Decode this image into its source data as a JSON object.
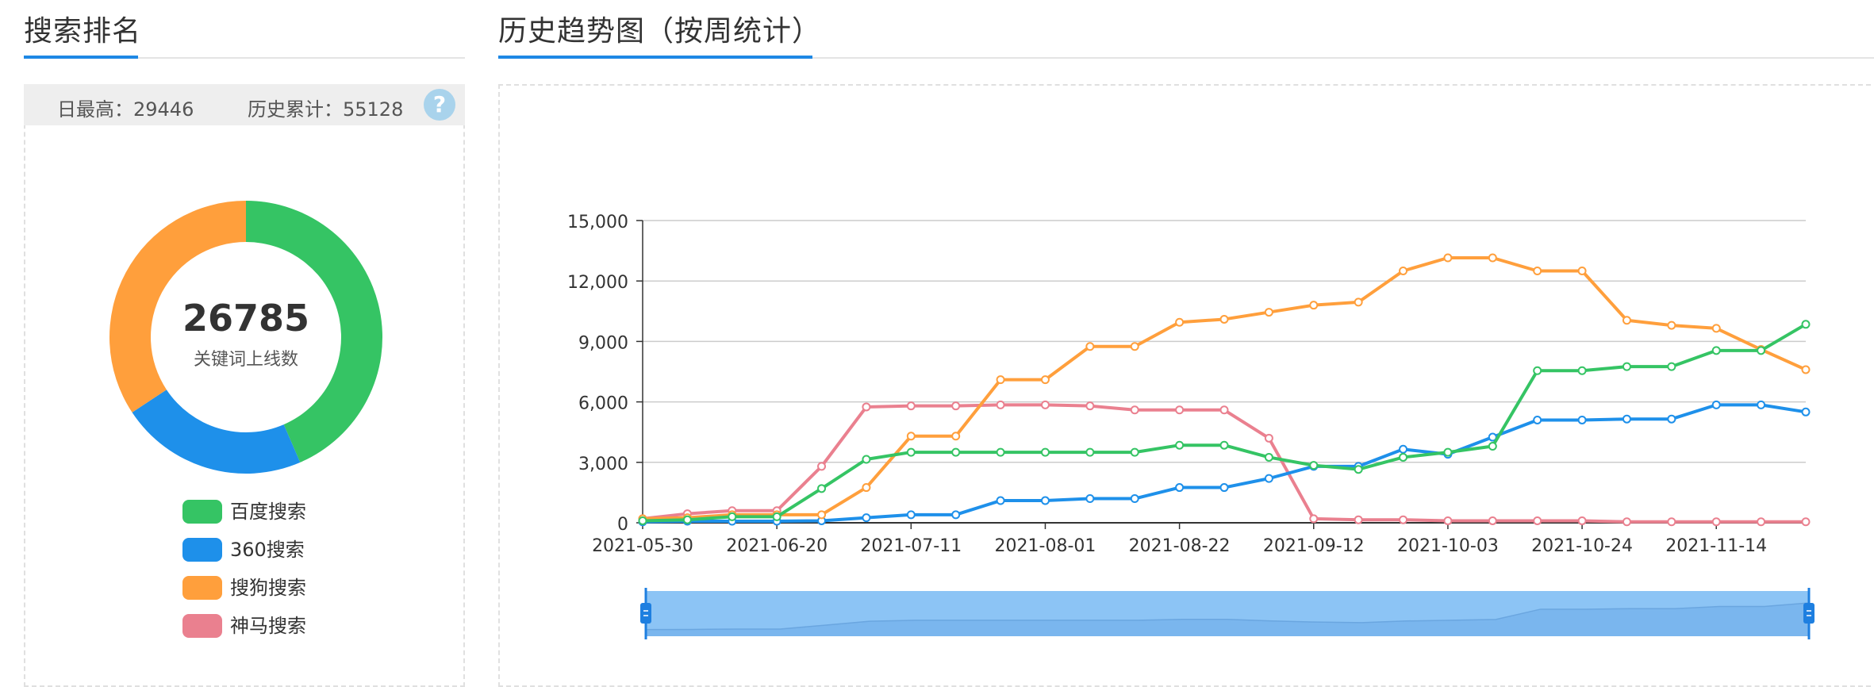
{
  "left_panel": {
    "title": "搜索排名",
    "stats": {
      "daily_max": "日最高：29446",
      "total": "历史累计：55128",
      "help": "?"
    },
    "donut": {
      "total": "26785",
      "caption": "关键词上线数",
      "slices": [
        {
          "name": "百度搜索",
          "value": 43.5,
          "color": "#35c464"
        },
        {
          "name": "360搜索",
          "value": 22.2,
          "color": "#1e90ea"
        },
        {
          "name": "搜狗搜索",
          "value": 34.3,
          "color": "#ff9f3c"
        }
      ]
    },
    "legend": [
      {
        "label": "百度搜索",
        "color": "#35c464"
      },
      {
        "label": "360搜索",
        "color": "#1e90ea"
      },
      {
        "label": "搜狗搜索",
        "color": "#ff9f3c"
      },
      {
        "label": "神马搜索",
        "color": "#ea808f"
      }
    ]
  },
  "right_panel": {
    "title": "历史趋势图（按周统计）"
  },
  "chart_data": {
    "type": "line",
    "ylim": [
      0,
      15000
    ],
    "yticks": [
      "0",
      "3,000",
      "6,000",
      "9,000",
      "12,000",
      "15,000"
    ],
    "ytick_values": [
      0,
      3000,
      6000,
      9000,
      12000,
      15000
    ],
    "xtick_labels": [
      "2021-05-30",
      "2021-06-20",
      "2021-07-11",
      "2021-08-01",
      "2021-08-22",
      "2021-09-12",
      "2021-10-03",
      "2021-10-24",
      "2021-11-14"
    ],
    "x": [
      "2021-05-30",
      "2021-06-06",
      "2021-06-13",
      "2021-06-20",
      "2021-06-27",
      "2021-07-04",
      "2021-07-11",
      "2021-07-18",
      "2021-07-25",
      "2021-08-01",
      "2021-08-08",
      "2021-08-15",
      "2021-08-22",
      "2021-08-29",
      "2021-09-05",
      "2021-09-12",
      "2021-09-19",
      "2021-09-26",
      "2021-10-03",
      "2021-10-10",
      "2021-10-17",
      "2021-10-24",
      "2021-10-31",
      "2021-11-07",
      "2021-11-14",
      "2021-11-21",
      "2021-11-28"
    ],
    "grid": true,
    "series": [
      {
        "name": "百度搜索",
        "color": "#35c464",
        "values": [
          100,
          150,
          300,
          300,
          1700,
          3150,
          3500,
          3500,
          3500,
          3500,
          3500,
          3500,
          3850,
          3850,
          3250,
          2850,
          2650,
          3250,
          3500,
          3800,
          7550,
          7550,
          7750,
          7750,
          8550,
          8550,
          9850
        ]
      },
      {
        "name": "360搜索",
        "color": "#1e90ea",
        "values": [
          50,
          80,
          80,
          80,
          100,
          250,
          400,
          400,
          1100,
          1100,
          1200,
          1200,
          1750,
          1750,
          2200,
          2800,
          2800,
          3650,
          3400,
          4250,
          5100,
          5100,
          5150,
          5150,
          5850,
          5850,
          5500
        ]
      },
      {
        "name": "搜狗搜索",
        "color": "#ff9f3c",
        "values": [
          200,
          250,
          400,
          400,
          400,
          1750,
          4300,
          4300,
          7100,
          7100,
          8750,
          8750,
          9950,
          10100,
          10450,
          10800,
          10950,
          12500,
          13150,
          13150,
          12500,
          12500,
          10050,
          9800,
          9650,
          8600,
          7600
        ]
      },
      {
        "name": "神马搜索",
        "color": "#ea808f",
        "values": [
          200,
          450,
          600,
          600,
          2800,
          5750,
          5800,
          5800,
          5850,
          5850,
          5800,
          5600,
          5600,
          5600,
          4200,
          200,
          150,
          150,
          100,
          100,
          100,
          100,
          50,
          50,
          50,
          50,
          50
        ]
      }
    ]
  }
}
